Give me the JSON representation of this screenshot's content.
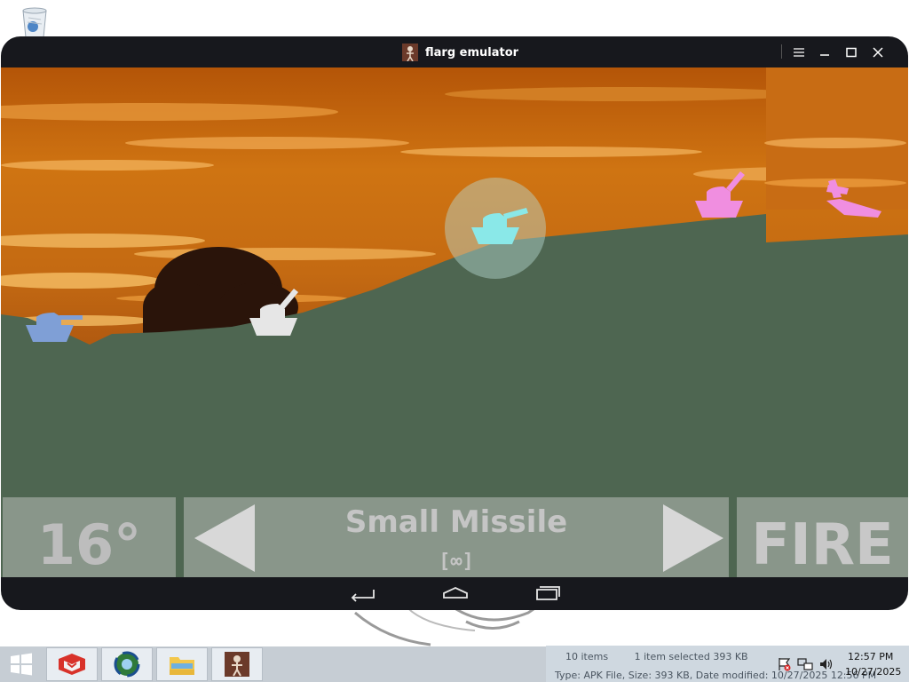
{
  "window": {
    "title": "flarg emulator"
  },
  "game": {
    "angle": "16°",
    "weapon_name": "Small Missile",
    "weapon_ammo": "[∞]",
    "fire_label": "FIRE"
  },
  "explorer_status": {
    "items": "10 items",
    "selected": "1 item selected  393 KB",
    "details": "Type: APK File, Size: 393 KB, Date modified: 10/27/2025 12:56 PM"
  },
  "clock": {
    "time": "12:57 PM",
    "date": "10/27/2025"
  },
  "colors": {
    "ground": "#4e6651",
    "tank_blue": "#7f9fd6",
    "tank_white": "#e6e6e6",
    "tank_cyan": "#8ae8e8",
    "tank_pink": "#f08ee0"
  },
  "taskbar": {
    "items": [
      "start-icon",
      "app-icon-red",
      "browser-icon",
      "file-explorer-icon",
      "flarg-emulator-icon"
    ]
  }
}
